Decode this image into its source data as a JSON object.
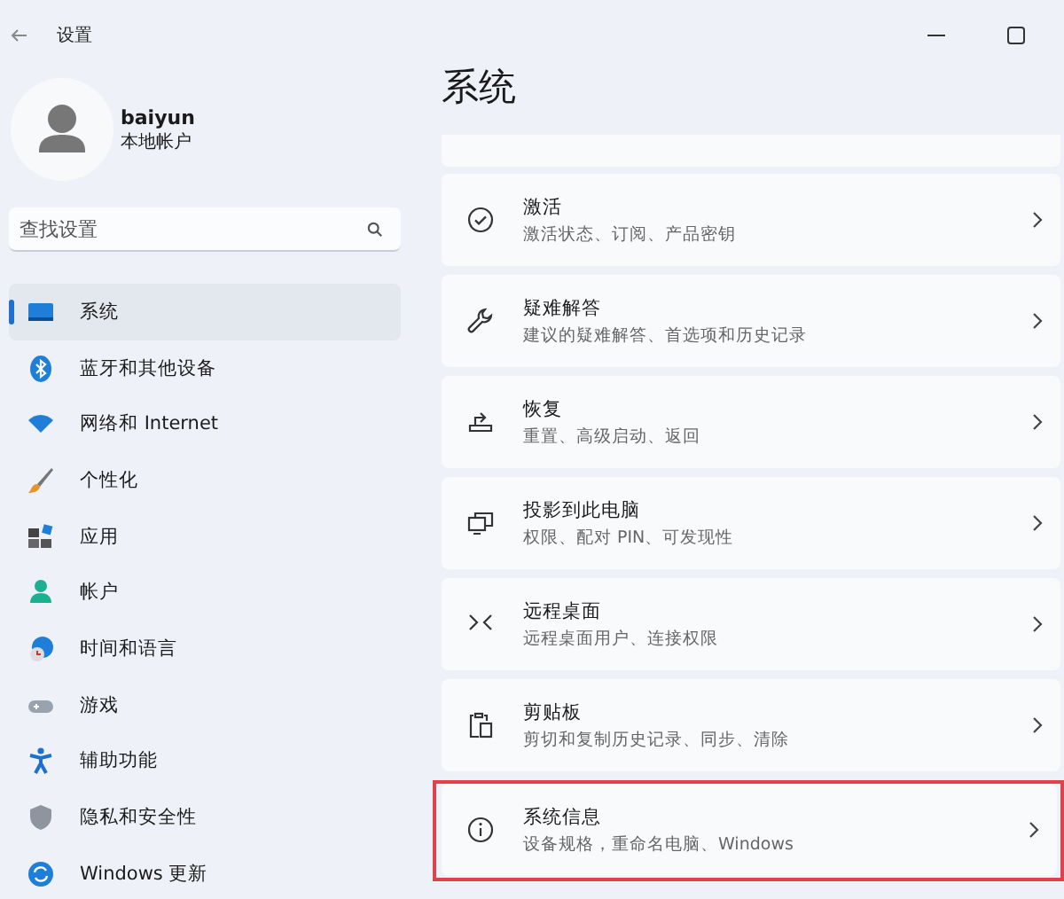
{
  "window": {
    "title": "设置"
  },
  "account": {
    "name": "baiyun",
    "type": "本地帐户"
  },
  "search": {
    "placeholder": "查找设置"
  },
  "nav": [
    {
      "label": "系统",
      "selected": true
    },
    {
      "label": "蓝牙和其他设备",
      "selected": false
    },
    {
      "label": "网络和 Internet",
      "selected": false
    },
    {
      "label": "个性化",
      "selected": false
    },
    {
      "label": "应用",
      "selected": false
    },
    {
      "label": "帐户",
      "selected": false
    },
    {
      "label": "时间和语言",
      "selected": false
    },
    {
      "label": "游戏",
      "selected": false
    },
    {
      "label": "辅助功能",
      "selected": false
    },
    {
      "label": "隐私和安全性",
      "selected": false
    },
    {
      "label": "Windows 更新",
      "selected": false
    }
  ],
  "page_title": "系统",
  "cards": [
    {
      "title": "激活",
      "subtitle": "激活状态、订阅、产品密钥",
      "highlighted": false
    },
    {
      "title": "疑难解答",
      "subtitle": "建议的疑难解答、首选项和历史记录",
      "highlighted": false
    },
    {
      "title": "恢复",
      "subtitle": "重置、高级启动、返回",
      "highlighted": false
    },
    {
      "title": "投影到此电脑",
      "subtitle": "权限、配对 PIN、可发现性",
      "highlighted": false
    },
    {
      "title": "远程桌面",
      "subtitle": "远程桌面用户、连接权限",
      "highlighted": false
    },
    {
      "title": "剪贴板",
      "subtitle": "剪切和复制历史记录、同步、清除",
      "highlighted": false
    },
    {
      "title": "系统信息",
      "subtitle": "设备规格，重命名电脑、Windows",
      "highlighted": true
    }
  ]
}
